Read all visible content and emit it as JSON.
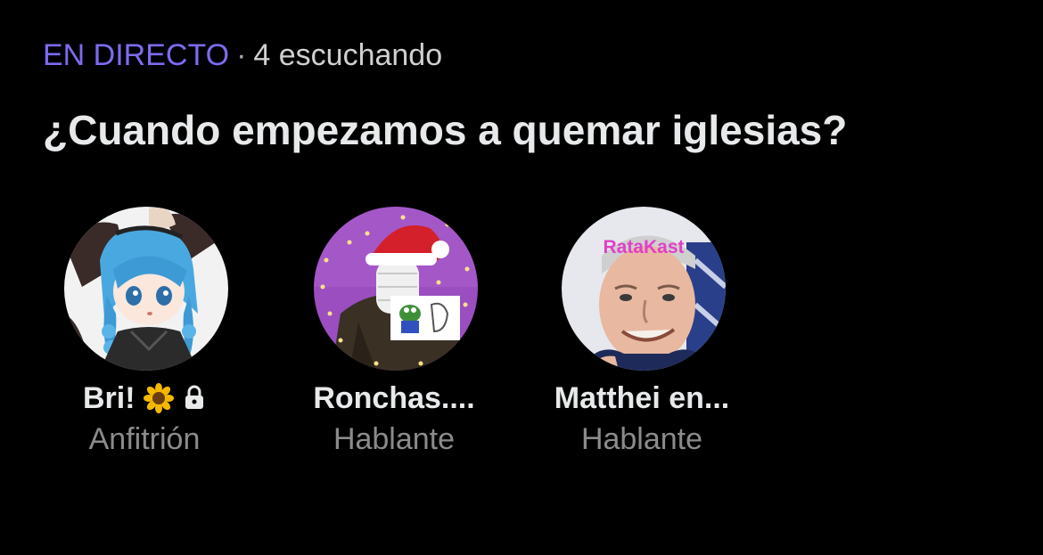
{
  "header": {
    "live_label": "EN DIRECTO",
    "separator": "·",
    "listeners": "4 escuchando"
  },
  "space": {
    "title": "¿Cuando empezamos a quemar iglesias?"
  },
  "participants": [
    {
      "name": "Bri!",
      "emoji": "🌻",
      "badge_icon": "lock-icon",
      "role": "Anfitrión",
      "avatar_icon": "anime-girl-avatar"
    },
    {
      "name": "Ronchas....",
      "role": "Hablante",
      "avatar_icon": "masked-santa-hat-avatar"
    },
    {
      "name": "Matthei en...",
      "role": "Hablante",
      "avatar_text": "RataKast",
      "avatar_icon": "smiling-man-avatar"
    }
  ],
  "colors": {
    "background": "#000000",
    "live_accent": "#7c6cf2",
    "text_primary": "#e7e9ea",
    "text_secondary": "#8b8b8b",
    "ratakast_pink": "#e040c8"
  }
}
